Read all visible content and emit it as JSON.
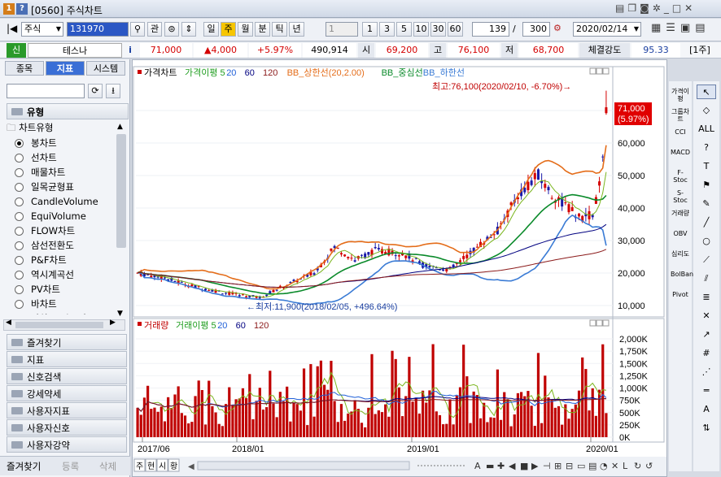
{
  "window": {
    "number_badge": "1",
    "help_badge": "?",
    "title": "[0560] 주식차트",
    "ctrl_icons": [
      "clipboard-icon",
      "copy-icon",
      "camera-icon",
      "gear-icon",
      "minimize-icon",
      "maximize-icon",
      "close-icon"
    ]
  },
  "toolbar": {
    "market": "주식",
    "code": "131970",
    "search_glyph": "⚲",
    "gwan": "관",
    "periods": [
      "일",
      "주",
      "월",
      "분",
      "틱",
      "년"
    ],
    "active_period": "주",
    "interval": "1",
    "quick_counts": [
      "1",
      "3",
      "5",
      "10",
      "30",
      "60"
    ],
    "count": "139",
    "sep": "/",
    "total": "300",
    "date": "2020/02/14"
  },
  "quote": {
    "tag": "신",
    "name": "테스나",
    "info": "i",
    "price": "71,000",
    "change": "▲4,000",
    "pct": "+5.97%",
    "volume": "490,914",
    "open_label": "시",
    "open": "69,200",
    "high_label": "고",
    "high": "76,100",
    "low_label": "저",
    "low": "68,700",
    "strength_label": "체결강도",
    "strength": "95.33",
    "unit": "[1주]"
  },
  "left": {
    "tabs": [
      "종목",
      "지표",
      "시스템"
    ],
    "active_tab": "지표",
    "group_type": "유형",
    "tree_label": "차트유형",
    "items": [
      "봉차트",
      "선차트",
      "매물차트",
      "일목균형표",
      "CandleVolume",
      "EquiVolume",
      "FLOW차트",
      "삼선전환도",
      "P&F차트",
      "역시계곡선",
      "PV차트",
      "바차트",
      "바차트(시고저종)"
    ],
    "selected": "봉차트",
    "groups": [
      "즐겨찾기",
      "지표",
      "신호검색",
      "강세약세",
      "사용자지표",
      "사용자신호",
      "사용자강약"
    ],
    "bottom_tabs": [
      "즐겨찾기",
      "등록",
      "삭제"
    ]
  },
  "chart": {
    "price_legend": [
      {
        "text": "가격차트",
        "color": "#000000"
      },
      {
        "text": "가격이평 5",
        "color": "#1f9d1f"
      },
      {
        "text": "20",
        "color": "#1f5fd8"
      },
      {
        "text": "60",
        "color": "#000080"
      },
      {
        "text": "120",
        "color": "#8b1a1a"
      },
      {
        "text": "BB_상한선(20,2.00)",
        "color": "#e46d1a"
      },
      {
        "text": "BB_중심선",
        "color": "#0a8a2a"
      },
      {
        "text": "BB_하한선",
        "color": "#3a7bd5"
      }
    ],
    "high_annotation": "최고:76,100(2020/02/10, -6.70%)→",
    "low_annotation": "←최저:11,900(2018/02/05, +496.64%)",
    "current_price_tag": "71,000",
    "current_pct_tag": "(5.97%)",
    "price_axis": [
      "70,000",
      "60,000",
      "50,000",
      "40,000",
      "30,000",
      "20,000",
      "10,000"
    ],
    "vol_legend": [
      {
        "text": "거래량",
        "color": "#c00000"
      },
      {
        "text": "거래이평 5",
        "color": "#1f9d1f"
      },
      {
        "text": "20",
        "color": "#1f5fd8"
      },
      {
        "text": "60",
        "color": "#000080"
      },
      {
        "text": "120",
        "color": "#8b1a1a"
      }
    ],
    "vol_axis": [
      "2,000K",
      "1,750K",
      "1,500K",
      "1,250K",
      "1,000K",
      "750K",
      "500K",
      "250K",
      "0K"
    ],
    "x_axis": [
      "2017/06",
      "2018/01",
      "2019/01",
      "2020/01"
    ],
    "bottom_buttons": [
      "주",
      "현",
      "시",
      "황"
    ]
  },
  "rightbar": {
    "items": [
      "가격이평",
      "그룹차트",
      "CCI",
      "MACD",
      "F-Stoc",
      "S-Stoc",
      "거래량",
      "OBV",
      "심리도",
      "BolBand",
      "Pivot"
    ]
  },
  "colors": {
    "up": "#d40000",
    "down": "#1a1aa8",
    "accent": "#f7c600"
  }
}
